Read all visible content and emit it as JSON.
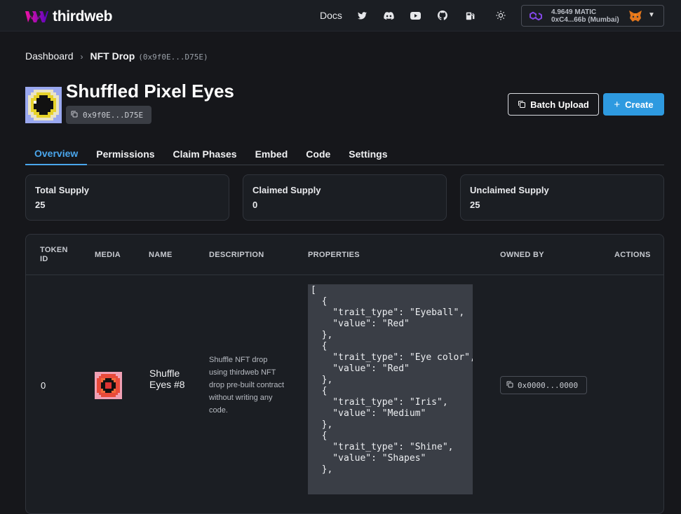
{
  "topbar": {
    "brand": "thirdweb",
    "docs": "Docs",
    "icons": [
      "twitter-icon",
      "discord-icon",
      "youtube-icon",
      "github-icon",
      "gas-pump-icon",
      "sun-icon"
    ],
    "wallet": {
      "balance": "4.9649 MATIC",
      "address": "0xC4...66b (Mumbai)"
    }
  },
  "breadcrumb": {
    "root": "Dashboard",
    "current": "NFT Drop",
    "address": "(0x9f0E...D75E)"
  },
  "header": {
    "title": "Shuffled Pixel Eyes",
    "address": "0x9f0E...D75E",
    "batch_upload": "Batch Upload",
    "create": "Create"
  },
  "tabs": [
    "Overview",
    "Permissions",
    "Claim Phases",
    "Embed",
    "Code",
    "Settings"
  ],
  "stats": [
    {
      "label": "Total Supply",
      "value": "25"
    },
    {
      "label": "Claimed Supply",
      "value": "0"
    },
    {
      "label": "Unclaimed Supply",
      "value": "25"
    }
  ],
  "table": {
    "columns": [
      "TOKEN ID",
      "MEDIA",
      "NAME",
      "DESCRIPTION",
      "PROPERTIES",
      "OWNED BY",
      "ACTIONS"
    ],
    "rows": [
      {
        "token_id": "0",
        "name": "Shuffle Eyes #8",
        "description": "Shuffle NFT drop using thirdweb NFT drop pre-built contract without writing any code.",
        "properties": "[\n  {\n    \"trait_type\": \"Eyeball\",\n    \"value\": \"Red\"\n  },\n  {\n    \"trait_type\": \"Eye color\",\n    \"value\": \"Red\"\n  },\n  {\n    \"trait_type\": \"Iris\",\n    \"value\": \"Medium\"\n  },\n  {\n    \"trait_type\": \"Shine\",\n    \"value\": \"Shapes\"\n  },",
        "owner": "0x0000...0000"
      }
    ]
  },
  "colors": {
    "accent": "#4aa6ec",
    "create_button": "#2e9ae0",
    "background": "#16171b",
    "brand_gradient": [
      "#f213a4",
      "#5204bf"
    ]
  }
}
